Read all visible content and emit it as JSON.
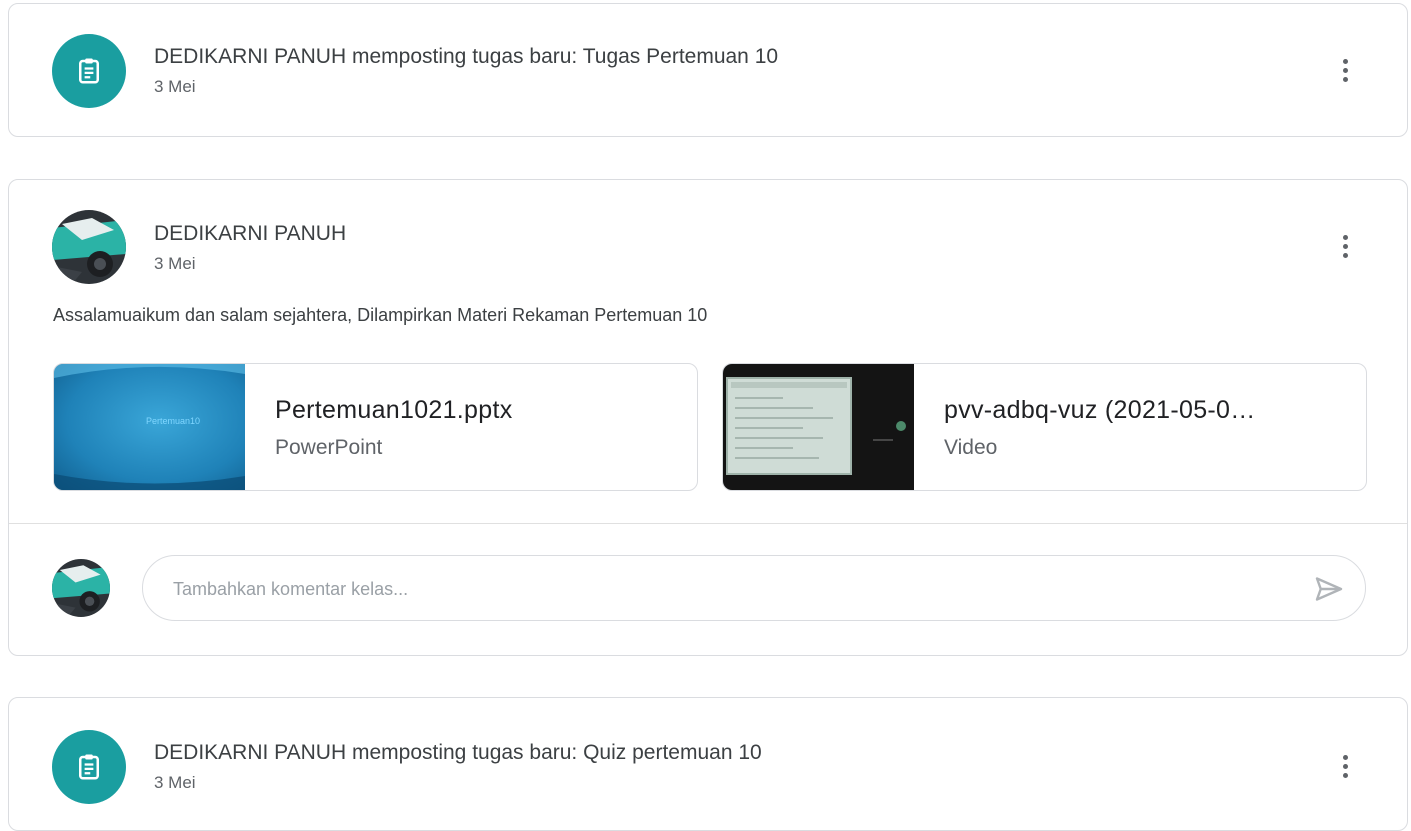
{
  "posts": [
    {
      "type": "assignment",
      "title": "DEDIKARNI PANUH memposting tugas baru: Tugas Pertemuan 10",
      "date": "3 Mei"
    },
    {
      "type": "announcement",
      "author": "DEDIKARNI PANUH",
      "date": "3 Mei",
      "body": "Assalamuaikum dan salam sejahtera, Dilampirkan Materi Rekaman Pertemuan 10",
      "attachments": [
        {
          "name": "Pertemuan1021.pptx",
          "type": "PowerPoint",
          "thumb_text": "Pertemuan10"
        },
        {
          "name": "pvv-adbq-vuz (2021-05-0…",
          "type": "Video"
        }
      ],
      "comment": {
        "placeholder": "Tambahkan komentar kelas...",
        "value": ""
      }
    },
    {
      "type": "assignment",
      "title": "DEDIKARNI PANUH memposting tugas baru: Quiz pertemuan 10",
      "date": "3 Mei"
    }
  ],
  "icons": {
    "assignment": "assignment-icon",
    "more": "more-vert-icon",
    "send": "send-icon"
  },
  "colors": {
    "accent": "#1a9ea0",
    "border": "#dadce0",
    "text": "#3c4043",
    "muted": "#5f6368"
  }
}
